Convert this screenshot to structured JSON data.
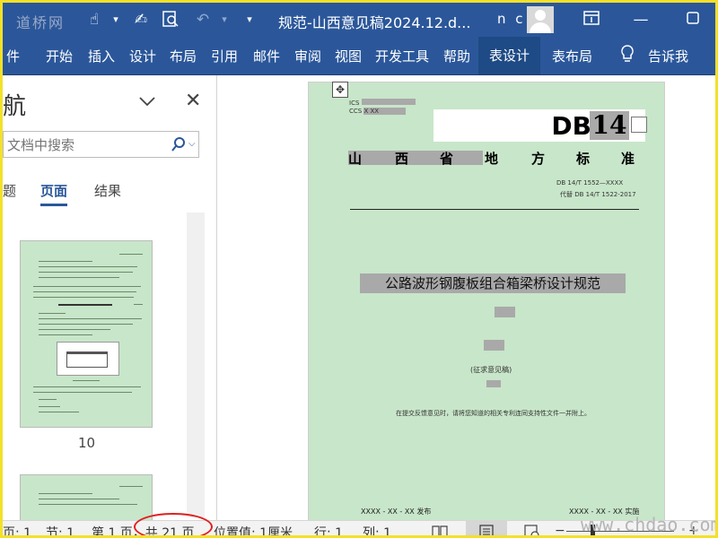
{
  "titlebar": {
    "document_title": "规范-山西意见稿2024.12.d...",
    "user": "n c",
    "watermark_text": "道桥网"
  },
  "ribbon": {
    "tabs": [
      "件",
      "开始",
      "插入",
      "设计",
      "布局",
      "引用",
      "邮件",
      "审阅",
      "视图",
      "开发工具",
      "帮助"
    ],
    "context_tabs": [
      "表设计",
      "表布局"
    ],
    "tell_me": "告诉我"
  },
  "nav": {
    "title": "航",
    "search_placeholder": "文档中搜索",
    "tabs": [
      "题",
      "页面",
      "结果"
    ],
    "active_tab": "页面",
    "thumbnail_page_number": "10"
  },
  "page": {
    "ics": "ICS",
    "ccs": "CCS",
    "ccs_value": "X XX",
    "db_label": "DB",
    "db_number": "14",
    "standard_chars": [
      "山",
      "西",
      "省",
      "地",
      "方",
      "标",
      "准"
    ],
    "doc_number": "DB 14/T 1552—XXXX",
    "replaces": "代替 DB 14/T 1522-2017",
    "main_title": "公路波形钢腹板组合箱梁桥设计规范",
    "draft_label": "(征求意见稿)",
    "notice": "在提交反馈意见时，请将您知道的相关专利连同支持性文件一并附上。",
    "issue_date": "XXXX - XX - XX 发布",
    "implement_date": "XXXX - XX - XX 实施"
  },
  "status": {
    "page_label": "页: 1",
    "section": "节: 1",
    "page_of": "第 1 页，共 21 页",
    "position": "位置值: 1厘米",
    "line": "行: 1",
    "column": "列: 1",
    "watermark": "www.chdao.com"
  }
}
